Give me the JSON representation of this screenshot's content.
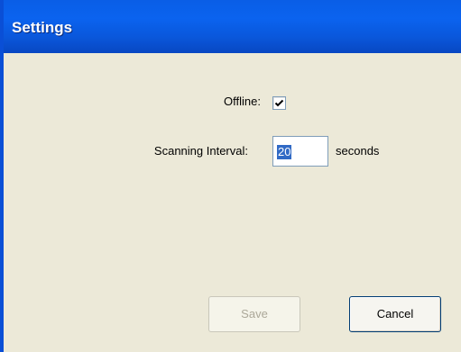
{
  "window": {
    "title": "Settings"
  },
  "form": {
    "offline_label": "Offline:",
    "offline_checked": true,
    "interval_label": "Scanning Interval:",
    "interval_value": "20",
    "interval_unit": "seconds"
  },
  "buttons": {
    "save_label": "Save",
    "save_enabled": false,
    "cancel_label": "Cancel"
  },
  "colors": {
    "titlebar": "#0a5ee6",
    "dialog_background": "#ece9d8",
    "selection": "#316ac5"
  }
}
